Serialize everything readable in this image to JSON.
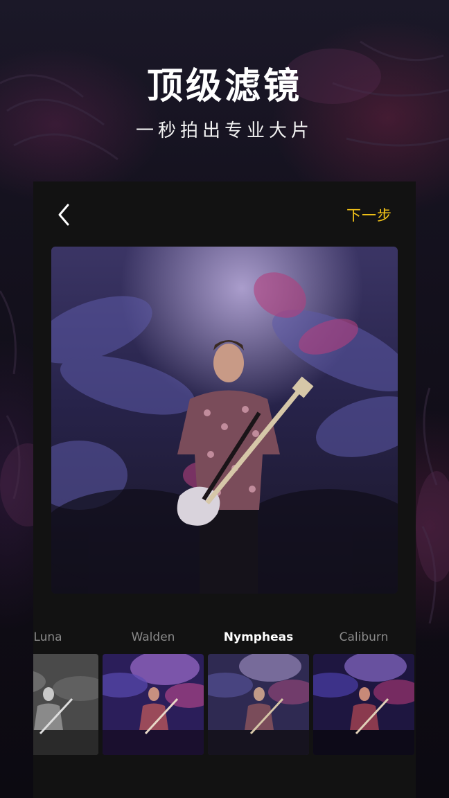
{
  "hero": {
    "title": "顶级滤镜",
    "subtitle": "一秒拍出专业大片"
  },
  "editor": {
    "back_icon": "chevron-left-icon",
    "next_label": "下一步",
    "accent_color": "#f5c518",
    "filters": [
      {
        "name": "Luna",
        "style": "grayscale",
        "selected": false
      },
      {
        "name": "Walden",
        "style": "violet",
        "selected": false
      },
      {
        "name": "Nympheas",
        "style": "muted-purple",
        "selected": true
      },
      {
        "name": "Caliburn",
        "style": "deep-purple",
        "selected": false
      }
    ]
  }
}
